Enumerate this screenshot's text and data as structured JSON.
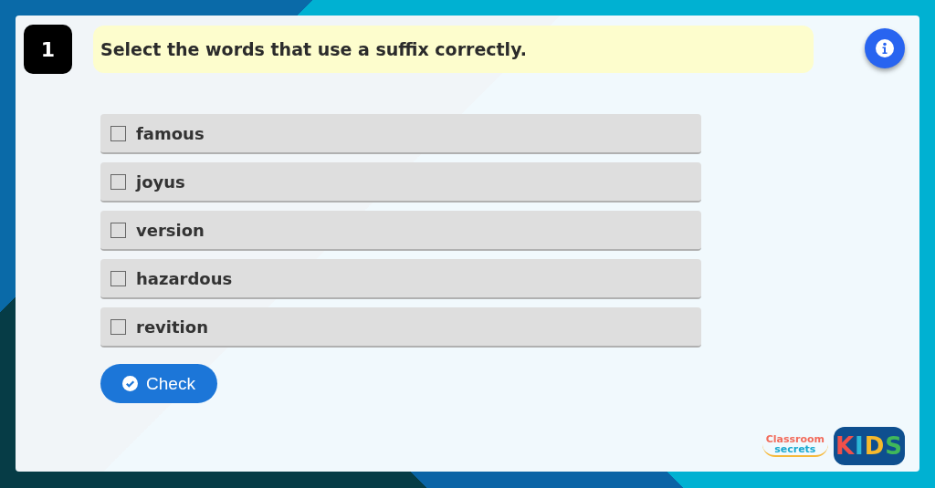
{
  "question": {
    "number": "1",
    "text": "Select the words that use a suffix correctly."
  },
  "options": [
    {
      "label": "famous",
      "checked": false
    },
    {
      "label": "joyus",
      "checked": false
    },
    {
      "label": "version",
      "checked": false
    },
    {
      "label": "hazardous",
      "checked": false
    },
    {
      "label": "revition",
      "checked": false
    }
  ],
  "check_button": {
    "label": "Check"
  },
  "logo": {
    "line_1": "Classroom",
    "line_2": "secrets",
    "badge": "KIDS"
  }
}
